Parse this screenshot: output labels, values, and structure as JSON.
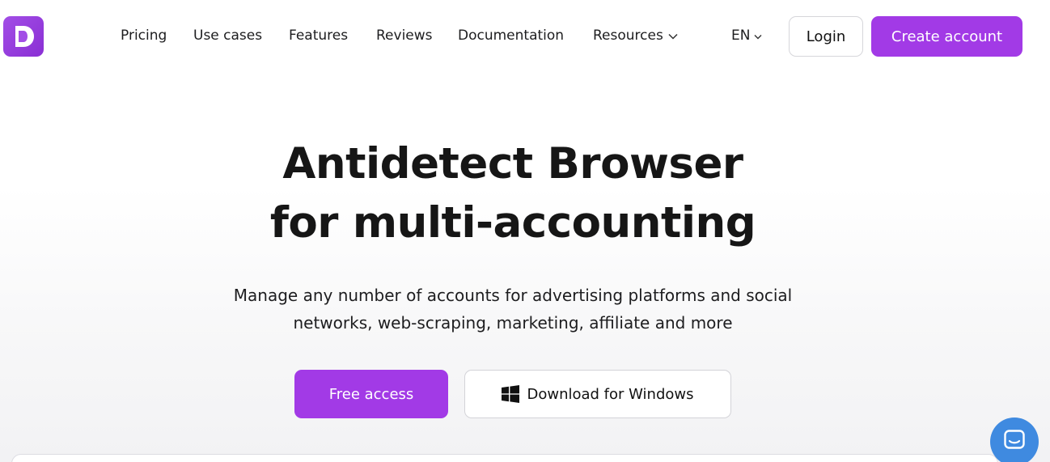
{
  "header": {
    "logo_icon": "d-logo-icon",
    "nav": {
      "pricing": "Pricing",
      "use_cases": "Use cases",
      "features": "Features",
      "reviews": "Reviews",
      "documentation": "Documentation",
      "resources": "Resources"
    },
    "language": "EN",
    "login_label": "Login",
    "create_account_label": "Create account"
  },
  "hero": {
    "title_line1": "Antidetect Browser",
    "title_line2": "for multi-accounting",
    "subtitle_line1": "Manage any number of accounts for advertising platforms and social",
    "subtitle_line2": "networks, web-scraping, marketing, affiliate and more",
    "free_access_label": "Free access",
    "download_label": "Download for Windows",
    "download_icon": "windows-icon"
  },
  "chat": {
    "icon": "chat-icon"
  },
  "colors": {
    "accent": "#a23ae6",
    "chat": "#3f8ae0",
    "text": "#161616"
  }
}
